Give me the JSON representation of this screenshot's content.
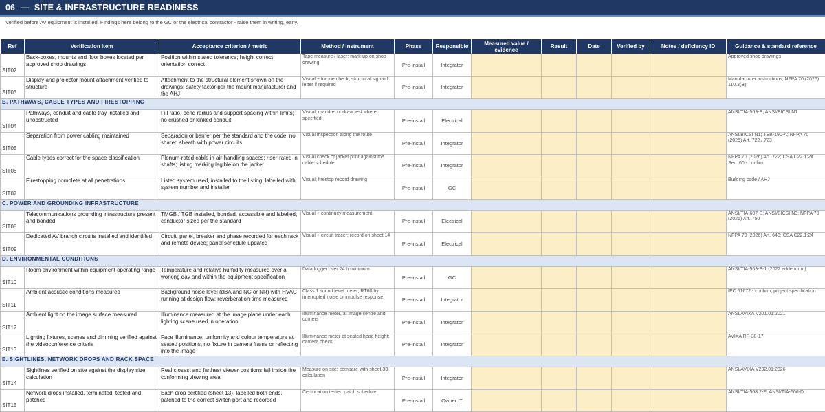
{
  "header": {
    "number": "06",
    "dash": "—",
    "title": "SITE & INFRASTRUCTURE READINESS",
    "subtitle": "Verified before AV equipment is installed. Findings here belong to the GC or the electrical contractor - raise them in writing, early."
  },
  "columns": {
    "ref": "Ref",
    "item": "Verification item",
    "criterion": "Acceptance criterion / metric",
    "method": "Method / instrument",
    "phase": "Phase",
    "responsible": "Responsible",
    "measured": "Measured value / evidence",
    "result": "Result",
    "date": "Date",
    "verified": "Verified by",
    "notes": "Notes / deficiency ID",
    "guidance": "Guidance & standard reference"
  },
  "colors": {
    "header_bg": "#1f3864",
    "section_bg": "#dbe5f4",
    "input_bg": "#fcefc6"
  },
  "rows": [
    {
      "ref": "SIT02",
      "item": "Back-boxes, mounts and floor boxes located per approved shop drawings",
      "criterion": "Position within stated tolerance; height correct; orientation correct",
      "method": "Tape measure / laser; mark-up on shop drawing",
      "phase": "Pre-install",
      "resp": "Integrator",
      "guide": "Approved shop drawings"
    },
    {
      "ref": "SIT03",
      "item": "Display and projector mount attachment verified to structure",
      "criterion": "Attachment to the structural element shown on the drawings; safety factor per the mount manufacturer and the AHJ",
      "method": "Visual + torque check; structural sign-off letter if required",
      "phase": "Pre-install",
      "resp": "Integrator",
      "guide": "Manufacturer instructions; NFPA 70 (2026) 110.3(B)"
    }
  ],
  "sections": [
    {
      "title": "B. PATHWAYS, CABLE TYPES AND FIRESTOPPING",
      "rows": [
        {
          "ref": "SIT04",
          "item": "Pathways, conduit and cable tray installed and unobstructed",
          "criterion": "Fill ratio, bend radius and support spacing within limits; no crushed or kinked conduit",
          "method": "Visual; mandrel or draw test where specified",
          "phase": "Pre-install",
          "resp": "Electrical",
          "guide": "ANSI/TIA-569-E; ANSI/BICSI N1"
        },
        {
          "ref": "SIT05",
          "item": "Separation from power cabling maintained",
          "criterion": "Separation or barrier per the standard and the code; no shared sheath with power circuits",
          "method": "Visual inspection along the route",
          "phase": "Pre-install",
          "resp": "Integrator",
          "guide": "ANSI/BICSI N1; TSB-190-A; NFPA 70 (2026) Art. 722 / 723"
        },
        {
          "ref": "SIT06",
          "item": "Cable types correct for the space classification",
          "criterion": "Plenum-rated cable in air-handling spaces; riser-rated in shafts; listing marking legible on the jacket",
          "method": "Visual check of jacket print against the cable schedule",
          "phase": "Pre-install",
          "resp": "Integrator",
          "guide": "NFPA 70 (2026) Art. 722; CSA C22.1:24 Sec. 60 - confirm"
        },
        {
          "ref": "SIT07",
          "item": "Firestopping complete at all penetrations",
          "criterion": "Listed system used, installed to the listing, labelled with system number and installer",
          "method": "Visual; firestop record drawing",
          "phase": "Pre-install",
          "resp": "GC",
          "guide": "Building code / AHJ"
        }
      ]
    },
    {
      "title": "C. POWER AND GROUNDING INFRASTRUCTURE",
      "rows": [
        {
          "ref": "SIT08",
          "item": "Telecommunications grounding infrastructure present and bonded",
          "criterion": "TMGB / TGB installed, bonded, accessible and labelled; conductor sized per the standard",
          "method": "Visual + continuity measurement",
          "phase": "Pre-install",
          "resp": "Electrical",
          "guide": "ANSI/TIA-607-E; ANSI/BICSI N3; NFPA 70 (2026) Art. 750"
        },
        {
          "ref": "SIT09",
          "item": "Dedicated AV branch circuits installed and identified",
          "criterion": "Circuit, panel, breaker and phase recorded for each rack and remote device; panel schedule updated",
          "method": "Visual + circuit tracer; record on sheet 14",
          "phase": "Pre-install",
          "resp": "Electrical",
          "guide": "NFPA 70 (2026) Art. 640; CSA C22.1:24"
        }
      ]
    },
    {
      "title": "D. ENVIRONMENTAL CONDITIONS",
      "rows": [
        {
          "ref": "SIT10",
          "item": "Room environment within equipment operating range",
          "criterion": "Temperature and relative humidity measured over a working day and within the equipment specification",
          "method": "Data logger over 24 h minimum",
          "phase": "Pre-install",
          "resp": "GC",
          "guide": "ANSI/TIA-569-E-1 (2022 addendum)"
        },
        {
          "ref": "SIT11",
          "item": "Ambient acoustic conditions measured",
          "criterion": "Background noise level (dBA and NC or NR) with HVAC running at design flow; reverberation time measured",
          "method": "Class 1 sound level meter; RT60 by interrupted noise or impulse response",
          "phase": "Pre-install",
          "resp": "Integrator",
          "guide": "IEC 61672 - confirm; project specification"
        },
        {
          "ref": "SIT12",
          "item": "Ambient light on the image surface measured",
          "criterion": "Illuminance measured at the image plane under each lighting scene used in operation",
          "method": "Illuminance meter, at image centre and corners",
          "phase": "Pre-install",
          "resp": "Integrator",
          "guide": "ANSI/AVIXA V201.01:2021"
        },
        {
          "ref": "SIT13",
          "item": "Lighting fixtures, scenes and dimming verified against the videoconference criteria",
          "criterion": "Face illuminance, uniformity and colour temperature at seated positions; no fixture in camera frame or reflecting into the image",
          "method": "Illuminance meter at seated head height; camera check",
          "phase": "Pre-install",
          "resp": "Integrator",
          "guide": "AVIXA RP-38-17"
        }
      ]
    },
    {
      "title": "E. SIGHTLINES, NETWORK DROPS AND RACK SPACE",
      "rows": [
        {
          "ref": "SIT14",
          "item": "Sightlines verified on site against the display size calculation",
          "criterion": "Real closest and farthest viewer positions fall inside the conforming viewing area",
          "method": "Measure on site; compare with sheet 33 calculation",
          "phase": "Pre-install",
          "resp": "Integrator",
          "guide": "ANSI/AVIXA V202.01:2026"
        },
        {
          "ref": "SIT15",
          "item": "Network drops installed, terminated, tested and patched",
          "criterion": "Each drop certified (sheet 13), labelled both ends, patched to the correct switch port and recorded",
          "method": "Certification tester; patch schedule",
          "phase": "Pre-install",
          "resp": "Owner IT",
          "guide": "ANSI/TIA-568.2-E; ANSI/TIA-606-D"
        }
      ]
    }
  ]
}
